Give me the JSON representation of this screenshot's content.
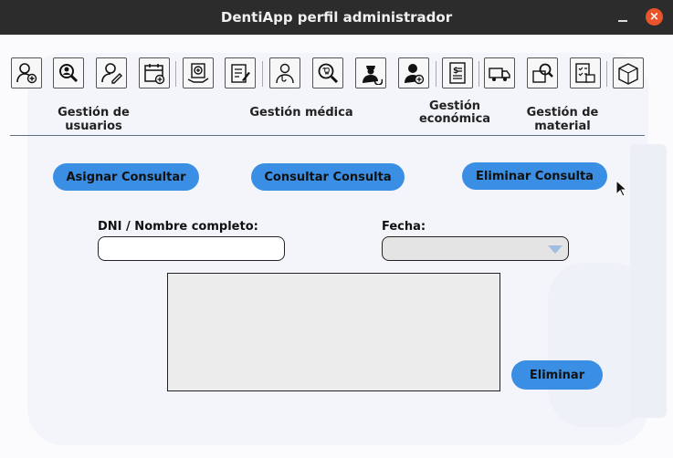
{
  "window": {
    "title": "DentiApp perfil administrador",
    "close_glyph": "×"
  },
  "toolbar": {
    "icons": [
      "user-add-icon",
      "user-search-icon",
      "user-edit-icon",
      "calendar-add-icon",
      "medical-record-icon",
      "clipboard-edit-icon",
      "doctor-icon",
      "search-tooth-icon",
      "nurse-refresh-icon",
      "doctor-add-icon",
      "invoice-icon",
      "delivery-truck-icon",
      "box-search-icon",
      "inventory-checklist-icon",
      "box-icon"
    ]
  },
  "sections": {
    "usuarios": "Gestión de usuarios",
    "medica": "Gestión médica",
    "economica_line1": "Gestión",
    "economica_line2": "económica",
    "material": "Gestión de material"
  },
  "buttons": {
    "asignar": "Asignar Consultar",
    "consultar": "Consultar Consulta",
    "eliminar_consulta": "Eliminar Consulta",
    "eliminar": "Eliminar"
  },
  "form": {
    "dni_label": "DNI / Nombre completo:",
    "dni_value": "",
    "fecha_label": "Fecha:",
    "fecha_value": "",
    "result_text": ""
  },
  "colors": {
    "accent": "#3a8fe4",
    "titlebar": "#2c2c2c",
    "close": "#e9542b"
  }
}
